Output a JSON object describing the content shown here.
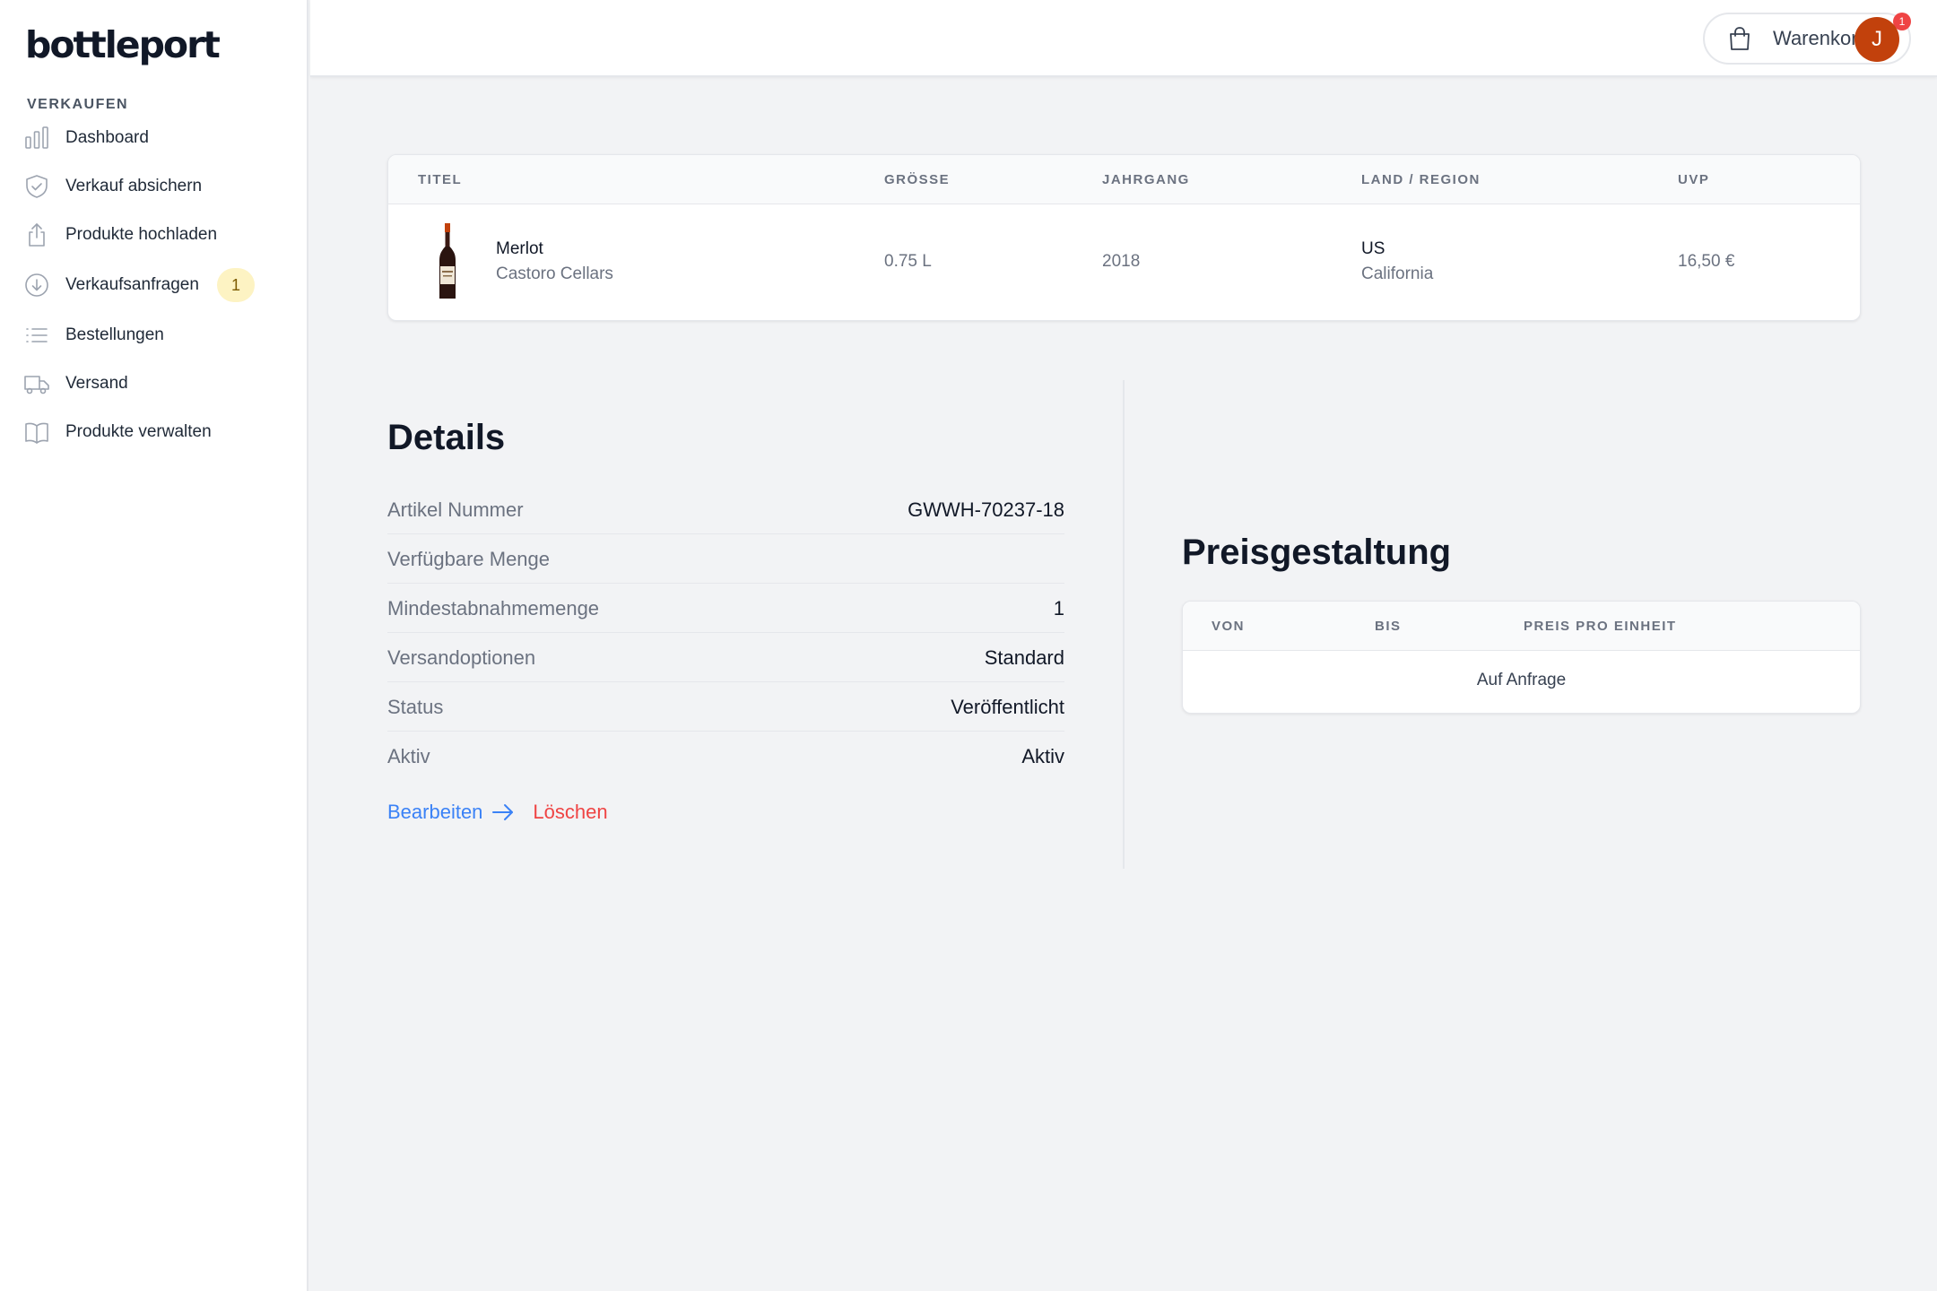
{
  "brand": {
    "logo_text": "bottleport"
  },
  "sidebar": {
    "section_label": "VERKAUFEN",
    "items": [
      {
        "label": "Dashboard",
        "icon": "bar-chart-icon"
      },
      {
        "label": "Verkauf absichern",
        "icon": "shield-check-icon"
      },
      {
        "label": "Produkte hochladen",
        "icon": "upload-icon"
      },
      {
        "label": "Verkaufsanfragen",
        "icon": "download-circle-icon",
        "badge": "1"
      },
      {
        "label": "Bestellungen",
        "icon": "list-icon"
      },
      {
        "label": "Versand",
        "icon": "truck-icon"
      },
      {
        "label": "Produkte verwalten",
        "icon": "book-open-icon"
      }
    ]
  },
  "header": {
    "cart_label": "Warenkorb",
    "cart_count": "1",
    "avatar_initial": "J"
  },
  "product_table": {
    "columns": [
      "TITEL",
      "GRÖSSE",
      "JAHRGANG",
      "LAND / REGION",
      "UVP"
    ],
    "row": {
      "name": "Merlot",
      "producer": "Castoro Cellars",
      "size": "0.75 L",
      "vintage": "2018",
      "country": "US",
      "region": "California",
      "price": "16,50 €"
    }
  },
  "details": {
    "title": "Details",
    "rows": [
      {
        "label": "Artikel Nummer",
        "value": "GWWH-70237-18"
      },
      {
        "label": "Verfügbare Menge",
        "value": ""
      },
      {
        "label": "Mindestabnahmemenge",
        "value": "1"
      },
      {
        "label": "Versandoptionen",
        "value": "Standard"
      },
      {
        "label": "Status",
        "value": "Veröffentlicht"
      },
      {
        "label": "Aktiv",
        "value": "Aktiv"
      }
    ],
    "edit_label": "Bearbeiten",
    "delete_label": "Löschen"
  },
  "pricing": {
    "title": "Preisgestaltung",
    "columns": [
      "VON",
      "BIS",
      "PREIS PRO EINHEIT"
    ],
    "empty_text": "Auf Anfrage"
  },
  "colors": {
    "accent_blue": "#3b82f6",
    "danger_red": "#ef4444",
    "avatar_bg": "#c2410c",
    "badge_bg": "#fdf3c3"
  }
}
